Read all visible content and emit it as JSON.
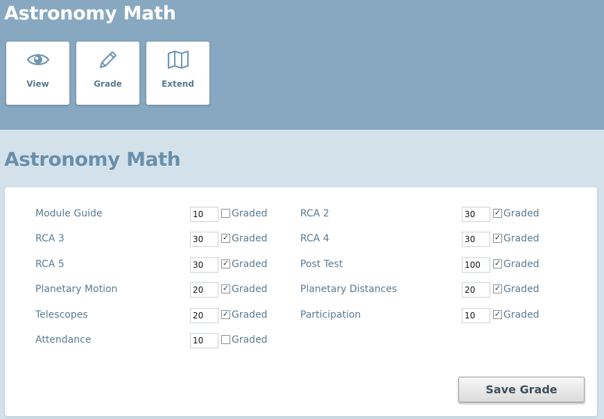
{
  "header": {
    "app_title": "Astronomy Math",
    "toolbar": [
      {
        "label": "View",
        "icon": "eye-icon"
      },
      {
        "label": "Grade",
        "icon": "pencil-icon"
      },
      {
        "label": "Extend",
        "icon": "map-icon"
      }
    ]
  },
  "page_title": "Astronomy Math",
  "graded_label": "Graded",
  "grades_left": [
    {
      "label": "Module Guide",
      "value": "10",
      "graded": false
    },
    {
      "label": "RCA 3",
      "value": "30",
      "graded": true
    },
    {
      "label": "RCA 5",
      "value": "30",
      "graded": true
    },
    {
      "label": "Planetary Motion",
      "value": "20",
      "graded": true
    },
    {
      "label": "Telescopes",
      "value": "20",
      "graded": true
    },
    {
      "label": "Attendance",
      "value": "10",
      "graded": false
    }
  ],
  "grades_right": [
    {
      "label": "RCA 2",
      "value": "30",
      "graded": true
    },
    {
      "label": "RCA 4",
      "value": "30",
      "graded": true
    },
    {
      "label": "Post Test",
      "value": "100",
      "graded": true
    },
    {
      "label": "Planetary Distances",
      "value": "20",
      "graded": true
    },
    {
      "label": "Participation",
      "value": "10",
      "graded": true
    }
  ],
  "save_label": "Save Grade",
  "colors": {
    "header_bg": "#87a8c0",
    "page_bg": "#d3e1eb",
    "label_text": "#5a7a92",
    "icon": "#6f95b1"
  }
}
